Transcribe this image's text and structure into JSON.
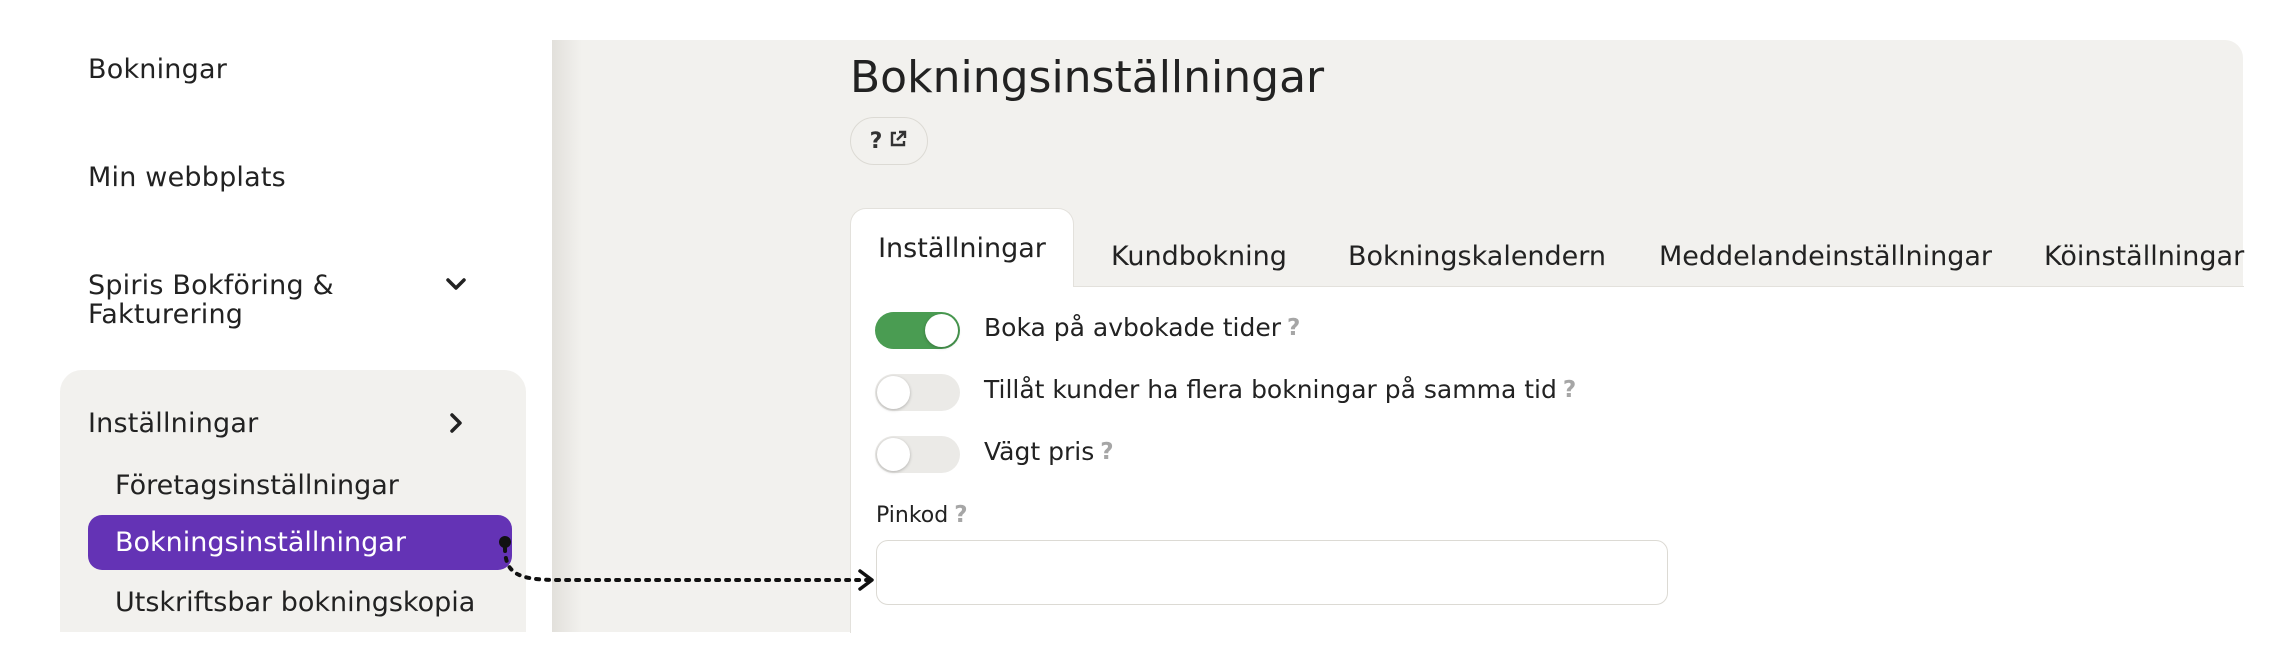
{
  "sidebar": {
    "items": [
      {
        "label": "Bokningar"
      },
      {
        "label": "Min webbplats"
      },
      {
        "label": "Spiris Bokföring & Fakturering"
      }
    ],
    "settings": {
      "label": "Inställningar",
      "children": [
        {
          "label": "Företagsinställningar"
        },
        {
          "label": "Bokningsinställningar",
          "active": true
        },
        {
          "label": "Utskriftsbar bokningskopia"
        }
      ]
    }
  },
  "page": {
    "title": "Bokningsinställningar",
    "help_icons": [
      "question-icon",
      "external-link-icon"
    ]
  },
  "tabs": [
    {
      "label": "Inställningar",
      "active": true
    },
    {
      "label": "Kundbokning"
    },
    {
      "label": "Bokningskalendern"
    },
    {
      "label": "Meddelandeinställningar"
    },
    {
      "label": "Köinställningar"
    }
  ],
  "options": [
    {
      "label": "Boka på avbokade tider",
      "enabled": true
    },
    {
      "label": "Tillåt kunder ha flera bokningar på samma tid",
      "enabled": false
    },
    {
      "label": "Vägt pris",
      "enabled": false
    }
  ],
  "pin": {
    "label": "Pinkod",
    "value": "",
    "placeholder": ""
  },
  "help_glyph": "?",
  "colors": {
    "accent": "#6433b5",
    "toggle_on": "#4a9c52",
    "toggle_off": "#ebeae7",
    "panel_bg": "#f2f1ee"
  }
}
